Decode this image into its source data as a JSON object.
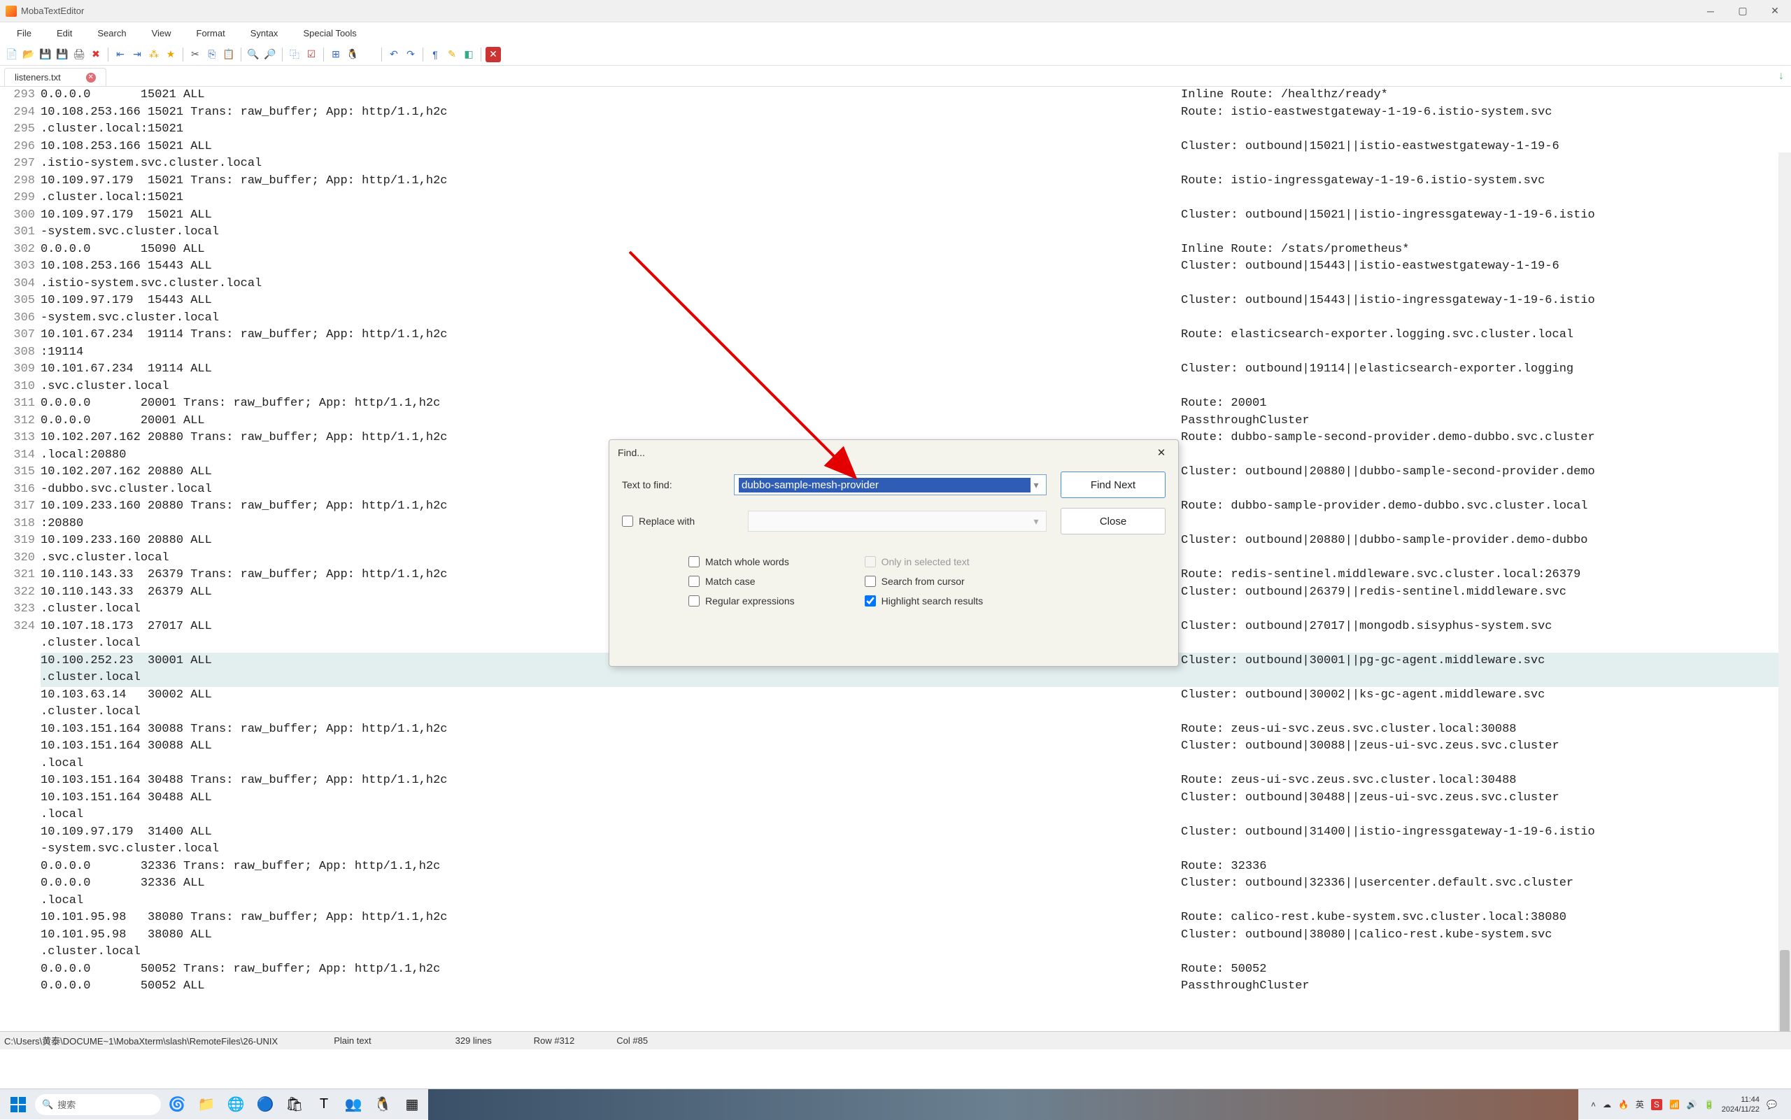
{
  "app_title": "MobaTextEditor",
  "menu": [
    "File",
    "Edit",
    "Search",
    "View",
    "Format",
    "Syntax",
    "Special Tools"
  ],
  "tab_name": "listeners.txt",
  "lines": [
    {
      "n": 293,
      "l": "0.0.0.0       15021 ALL",
      "r": "Inline Route: /healthz/ready*"
    },
    {
      "n": 294,
      "l": "10.108.253.166 15021 Trans: raw_buffer; App: http/1.1,h2c",
      "r": "Route: istio-eastwestgateway-1-19-6.istio-system.svc"
    },
    {
      "n": "",
      "l": ".cluster.local:15021",
      "r": ""
    },
    {
      "n": 295,
      "l": "10.108.253.166 15021 ALL",
      "r": "Cluster: outbound|15021||istio-eastwestgateway-1-19-6"
    },
    {
      "n": "",
      "l": ".istio-system.svc.cluster.local",
      "r": ""
    },
    {
      "n": 296,
      "l": "10.109.97.179  15021 Trans: raw_buffer; App: http/1.1,h2c",
      "r": "Route: istio-ingressgateway-1-19-6.istio-system.svc"
    },
    {
      "n": "",
      "l": ".cluster.local:15021",
      "r": ""
    },
    {
      "n": 297,
      "l": "10.109.97.179  15021 ALL",
      "r": "Cluster: outbound|15021||istio-ingressgateway-1-19-6.istio"
    },
    {
      "n": "",
      "l": "-system.svc.cluster.local",
      "r": ""
    },
    {
      "n": 298,
      "l": "0.0.0.0       15090 ALL",
      "r": "Inline Route: /stats/prometheus*"
    },
    {
      "n": 299,
      "l": "10.108.253.166 15443 ALL",
      "r": "Cluster: outbound|15443||istio-eastwestgateway-1-19-6"
    },
    {
      "n": "",
      "l": ".istio-system.svc.cluster.local",
      "r": ""
    },
    {
      "n": 300,
      "l": "10.109.97.179  15443 ALL",
      "r": "Cluster: outbound|15443||istio-ingressgateway-1-19-6.istio"
    },
    {
      "n": "",
      "l": "-system.svc.cluster.local",
      "r": ""
    },
    {
      "n": 301,
      "l": "10.101.67.234  19114 Trans: raw_buffer; App: http/1.1,h2c",
      "r": "Route: elasticsearch-exporter.logging.svc.cluster.local"
    },
    {
      "n": "",
      "l": ":19114",
      "r": ""
    },
    {
      "n": 302,
      "l": "10.101.67.234  19114 ALL",
      "r": "Cluster: outbound|19114||elasticsearch-exporter.logging"
    },
    {
      "n": "",
      "l": ".svc.cluster.local",
      "r": ""
    },
    {
      "n": 303,
      "l": "0.0.0.0       20001 Trans: raw_buffer; App: http/1.1,h2c",
      "r": "Route: 20001"
    },
    {
      "n": 304,
      "l": "0.0.0.0       20001 ALL",
      "r": "PassthroughCluster"
    },
    {
      "n": 305,
      "l": "10.102.207.162 20880 Trans: raw_buffer; App: http/1.1,h2c",
      "r": "Route: dubbo-sample-second-provider.demo-dubbo.svc.cluster"
    },
    {
      "n": "",
      "l": ".local:20880",
      "r": ""
    },
    {
      "n": 306,
      "l": "10.102.207.162 20880 ALL",
      "r": "Cluster: outbound|20880||dubbo-sample-second-provider.demo"
    },
    {
      "n": "",
      "l": "-dubbo.svc.cluster.local",
      "r": ""
    },
    {
      "n": 307,
      "l": "10.109.233.160 20880 Trans: raw_buffer; App: http/1.1,h2c",
      "r": "Route: dubbo-sample-provider.demo-dubbo.svc.cluster.local"
    },
    {
      "n": "",
      "l": ":20880",
      "r": ""
    },
    {
      "n": 308,
      "l": "10.109.233.160 20880 ALL",
      "r": "Cluster: outbound|20880||dubbo-sample-provider.demo-dubbo"
    },
    {
      "n": "",
      "l": ".svc.cluster.local",
      "r": ""
    },
    {
      "n": 309,
      "l": "10.110.143.33  26379 Trans: raw_buffer; App: http/1.1,h2c",
      "r": "Route: redis-sentinel.middleware.svc.cluster.local:26379"
    },
    {
      "n": 310,
      "l": "10.110.143.33  26379 ALL",
      "r": "Cluster: outbound|26379||redis-sentinel.middleware.svc"
    },
    {
      "n": "",
      "l": ".cluster.local",
      "r": ""
    },
    {
      "n": 311,
      "l": "10.107.18.173  27017 ALL",
      "r": "Cluster: outbound|27017||mongodb.sisyphus-system.svc"
    },
    {
      "n": "",
      "l": ".cluster.local",
      "r": ""
    },
    {
      "n": 312,
      "l": "10.100.252.23  30001 ALL",
      "r": "Cluster: outbound|30001||pg-gc-agent.middleware.svc",
      "hl": true
    },
    {
      "n": "",
      "l": ".cluster.local",
      "r": "",
      "hl": true
    },
    {
      "n": 313,
      "l": "10.103.63.14   30002 ALL",
      "r": "Cluster: outbound|30002||ks-gc-agent.middleware.svc"
    },
    {
      "n": "",
      "l": ".cluster.local",
      "r": ""
    },
    {
      "n": 314,
      "l": "10.103.151.164 30088 Trans: raw_buffer; App: http/1.1,h2c",
      "r": "Route: zeus-ui-svc.zeus.svc.cluster.local:30088"
    },
    {
      "n": 315,
      "l": "10.103.151.164 30088 ALL",
      "r": "Cluster: outbound|30088||zeus-ui-svc.zeus.svc.cluster"
    },
    {
      "n": "",
      "l": ".local",
      "r": ""
    },
    {
      "n": 316,
      "l": "10.103.151.164 30488 Trans: raw_buffer; App: http/1.1,h2c",
      "r": "Route: zeus-ui-svc.zeus.svc.cluster.local:30488"
    },
    {
      "n": 317,
      "l": "10.103.151.164 30488 ALL",
      "r": "Cluster: outbound|30488||zeus-ui-svc.zeus.svc.cluster"
    },
    {
      "n": "",
      "l": ".local",
      "r": ""
    },
    {
      "n": 318,
      "l": "10.109.97.179  31400 ALL",
      "r": "Cluster: outbound|31400||istio-ingressgateway-1-19-6.istio"
    },
    {
      "n": "",
      "l": "-system.svc.cluster.local",
      "r": ""
    },
    {
      "n": 319,
      "l": "0.0.0.0       32336 Trans: raw_buffer; App: http/1.1,h2c",
      "r": "Route: 32336"
    },
    {
      "n": 320,
      "l": "0.0.0.0       32336 ALL",
      "r": "Cluster: outbound|32336||usercenter.default.svc.cluster"
    },
    {
      "n": "",
      "l": ".local",
      "r": ""
    },
    {
      "n": 321,
      "l": "10.101.95.98   38080 Trans: raw_buffer; App: http/1.1,h2c",
      "r": "Route: calico-rest.kube-system.svc.cluster.local:38080"
    },
    {
      "n": 322,
      "l": "10.101.95.98   38080 ALL",
      "r": "Cluster: outbound|38080||calico-rest.kube-system.svc"
    },
    {
      "n": "",
      "l": ".cluster.local",
      "r": ""
    },
    {
      "n": 323,
      "l": "0.0.0.0       50052 Trans: raw_buffer; App: http/1.1,h2c",
      "r": "Route: 50052"
    },
    {
      "n": 324,
      "l": "0.0.0.0       50052 ALL",
      "r": "PassthroughCluster"
    }
  ],
  "find": {
    "title": "Find...",
    "text_label": "Text to find:",
    "text_value": "dubbo-sample-mesh-provider",
    "replace_label": "Replace with",
    "find_next": "Find Next",
    "close": "Close",
    "opts": {
      "whole": "Match whole words",
      "case": "Match case",
      "regex": "Regular expressions",
      "selected": "Only in selected text",
      "cursor": "Search from cursor",
      "highlight": "Highlight search results"
    }
  },
  "status": {
    "path": "C:\\Users\\黄泰\\DOCUME~1\\MobaXterm\\slash\\RemoteFiles\\26-UNIX",
    "syntax": "Plain text",
    "lines": "329 lines",
    "row": "Row #312",
    "col": "Col #85"
  },
  "taskbar": {
    "search": "搜索",
    "ime": "英",
    "time": "11:44",
    "date": "2024/11/22"
  }
}
